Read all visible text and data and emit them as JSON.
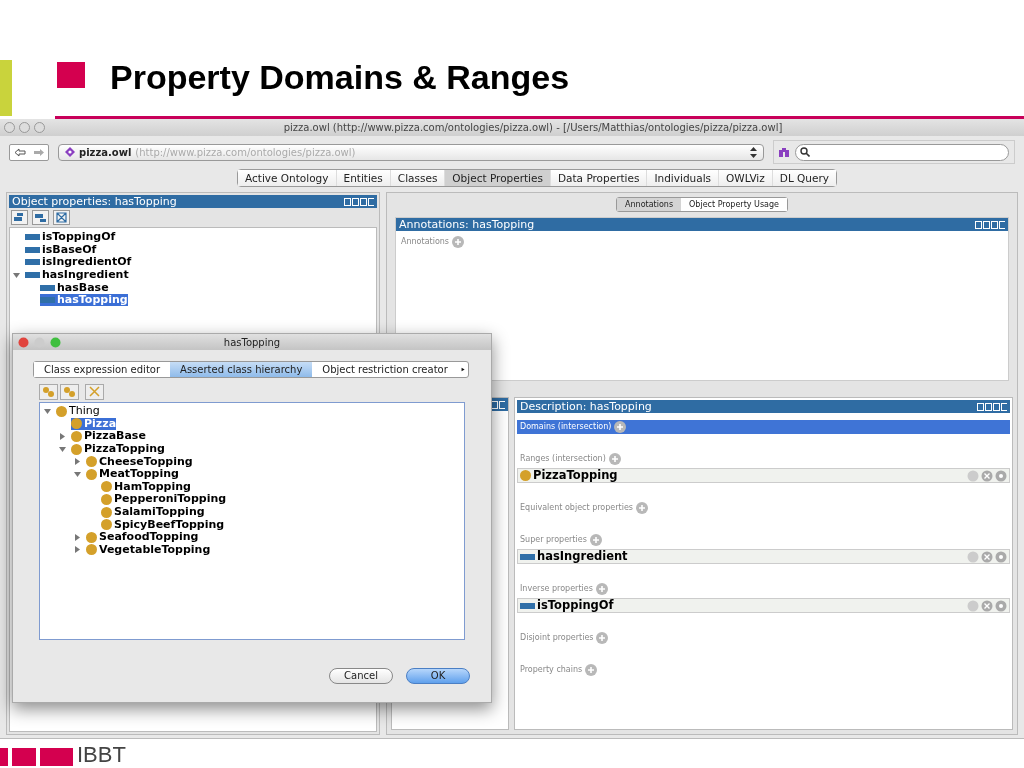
{
  "slide": {
    "title": "Property Domains & Ranges",
    "logo_text": "IBBT"
  },
  "window": {
    "title": "pizza.owl (http://www.pizza.com/ontologies/pizza.owl) - [/Users/Matthias/ontologies/pizza/pizza.owl]",
    "address": {
      "name": "pizza.owl",
      "iri": "(http://www.pizza.com/ontologies/pizza.owl)"
    },
    "tabs": [
      {
        "label": "Active Ontology",
        "selected": false
      },
      {
        "label": "Entities",
        "selected": false
      },
      {
        "label": "Classes",
        "selected": false
      },
      {
        "label": "Object Properties",
        "selected": true
      },
      {
        "label": "Data Properties",
        "selected": false
      },
      {
        "label": "Individuals",
        "selected": false
      },
      {
        "label": "OWLViz",
        "selected": false
      },
      {
        "label": "DL Query",
        "selected": false
      }
    ],
    "left_panel": {
      "title": "Object properties: hasTopping",
      "tree": [
        {
          "label": "isToppingOf",
          "selected": false
        },
        {
          "label": "isBaseOf",
          "selected": false
        },
        {
          "label": "isIngredientOf",
          "selected": false
        },
        {
          "label": "hasIngredient",
          "selected": false,
          "expanded": true,
          "children": [
            {
              "label": "hasBase",
              "selected": false
            },
            {
              "label": "hasTopping",
              "selected": true
            }
          ]
        }
      ]
    },
    "subtabs": [
      {
        "label": "Annotations",
        "selected": true
      },
      {
        "label": "Object Property Usage",
        "selected": false
      }
    ],
    "annotations_panel": {
      "title": "Annotations: hasTopping",
      "section": "Annotations"
    },
    "description_panel": {
      "title": "Description: hasTopping",
      "sections": [
        {
          "label": "Domains (intersection)",
          "selected": true
        },
        {
          "label": "Ranges (intersection)",
          "selected": false,
          "items": [
            {
              "label": "PizzaTopping",
              "kind": "class"
            }
          ]
        },
        {
          "label": "Equivalent object properties",
          "selected": false
        },
        {
          "label": "Super properties",
          "selected": false,
          "items": [
            {
              "label": "hasIngredient",
              "kind": "property"
            }
          ]
        },
        {
          "label": "Inverse properties",
          "selected": false,
          "items": [
            {
              "label": "isToppingOf",
              "kind": "property"
            }
          ]
        },
        {
          "label": "Disjoint properties",
          "selected": false
        },
        {
          "label": "Property chains",
          "selected": false
        }
      ]
    }
  },
  "dialog": {
    "title": "hasTopping",
    "tabs": [
      {
        "label": "Class expression editor",
        "selected": false
      },
      {
        "label": "Asserted class hierarchy",
        "selected": true
      },
      {
        "label": "Object restriction creator",
        "selected": false
      }
    ],
    "tree": [
      {
        "label": "Thing",
        "selected": false,
        "expanded": true,
        "children": [
          {
            "label": "Pizza",
            "selected": true
          },
          {
            "label": "PizzaBase",
            "selected": false,
            "expanded": false
          },
          {
            "label": "PizzaTopping",
            "selected": false,
            "expanded": true,
            "children": [
              {
                "label": "CheeseTopping",
                "selected": false,
                "expanded": false
              },
              {
                "label": "MeatTopping",
                "selected": false,
                "expanded": true,
                "children": [
                  {
                    "label": "HamTopping",
                    "selected": false
                  },
                  {
                    "label": "PepperoniTopping",
                    "selected": false
                  },
                  {
                    "label": "SalamiTopping",
                    "selected": false
                  },
                  {
                    "label": "SpicyBeefTopping",
                    "selected": false
                  }
                ]
              },
              {
                "label": "SeafoodTopping",
                "selected": false,
                "expanded": false
              },
              {
                "label": "VegetableTopping",
                "selected": false,
                "expanded": false
              }
            ]
          }
        ]
      }
    ],
    "buttons": [
      {
        "label": "Cancel",
        "default": false
      },
      {
        "label": "OK",
        "default": true
      }
    ]
  }
}
